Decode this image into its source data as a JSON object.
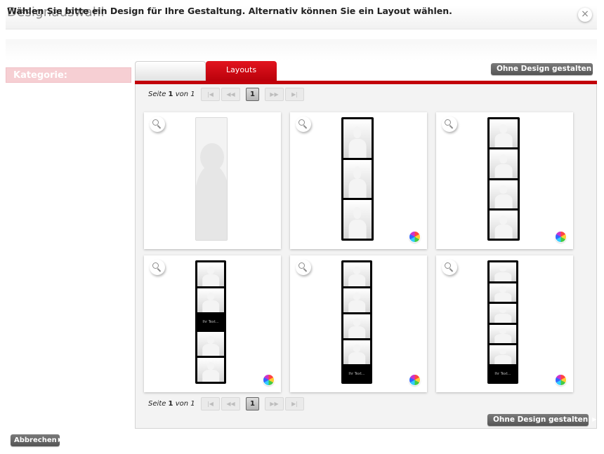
{
  "dialog": {
    "title": "Designauswahl",
    "close_symbol": "×",
    "instruction": "Wählen Sie bitte ein Design für Ihre Gestaltung. Alternativ können Sie ein Layout wählen."
  },
  "sidebar": {
    "category_label": "Kategorie:"
  },
  "tabs": [
    {
      "label": ""
    },
    {
      "label": "Layouts",
      "active": true
    }
  ],
  "buttons": {
    "no_design": "Ohne Design gestalten",
    "cancel": "Abbrechen"
  },
  "pagination": {
    "page_word": "Seite",
    "current": "1",
    "of_word": "von",
    "total": "1",
    "first": "|◀",
    "prev": "◀◀",
    "next": "▶▶",
    "last": "▶|"
  },
  "layouts": [
    {
      "frames": 0,
      "text_panel": false,
      "color_icon": false
    },
    {
      "frames": 3,
      "text_panel": false,
      "color_icon": true
    },
    {
      "frames": 4,
      "text_panel": false,
      "color_icon": true
    },
    {
      "frames": 4,
      "text_panel": true,
      "text_slot": 2,
      "text": "Ihr Text...",
      "color_icon": true
    },
    {
      "frames": 4,
      "text_panel": true,
      "text_slot": 4,
      "text": "Ihr Text...",
      "color_icon": true
    },
    {
      "frames": 5,
      "text_panel": true,
      "text_slot": 5,
      "text": "Ihr Text...",
      "color_icon": true
    }
  ],
  "colors": {
    "accent_red": "#c2000b",
    "category_bg": "#f6cfd3",
    "button_gray": "#666666"
  }
}
